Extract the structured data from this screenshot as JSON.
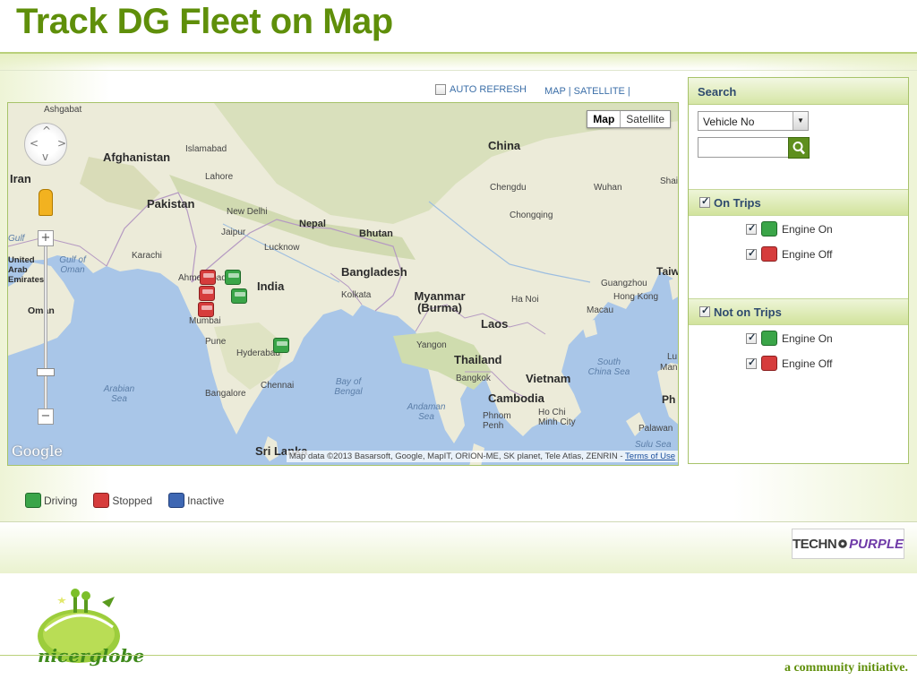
{
  "slide": {
    "title": "Track DG Fleet on Map",
    "footer_tagline": "a community initiative.",
    "footer_logo": "nicerglobe",
    "partner_logo": {
      "part1": "TECHN",
      "part2": "PURPLE"
    }
  },
  "toolbar": {
    "auto_refresh_label": "AUTO REFRESH",
    "map_links": "MAP | SATELLITE |"
  },
  "map": {
    "map_type_buttons": [
      "Map",
      "Satellite"
    ],
    "selected_map_type": "Map",
    "countries": [
      "Afghanistan",
      "Iran",
      "Pakistan",
      "Nepal",
      "Bhutan",
      "India",
      "Bangladesh",
      "China",
      "Myanmar (Burma)",
      "Laos",
      "Thailand",
      "Vietnam",
      "Cambodia",
      "Sri Lanka",
      "Taiw",
      "Ph",
      "United Arab Emirates",
      "Oman"
    ],
    "cities": [
      "Ashgabat",
      "Islamabad",
      "Lahore",
      "New Delhi",
      "Jaipur",
      "Lucknow",
      "Karachi",
      "Ahmedabad",
      "Kolkata",
      "Mumbai",
      "Pune",
      "Hyderabad",
      "Bangalore",
      "Chennai",
      "Yangon",
      "Bangkok",
      "Phnom Penh",
      "Ho Chi Minh City",
      "Ha Noi",
      "Chengdu",
      "Chongqing",
      "Wuhan",
      "Guangzhou",
      "Hong Kong",
      "Macau",
      "Shai",
      "Palawan",
      "Lu",
      "Man"
    ],
    "seas": [
      "Gulf of Oman",
      "Arabian Sea",
      "Bay of Bengal",
      "Andaman Sea",
      "South China Sea",
      "Sulu Sea",
      "Gulf"
    ],
    "google_logo": "Google",
    "attribution": "Map data ©2013 Basarsoft, Google, MapIT, ORION-ME, SK planet, Tele Atlas, ZENRIN -",
    "terms_link": "Terms of Use",
    "zoom_in": "+",
    "zoom_out": "−",
    "vehicles": [
      {
        "status": "stopped",
        "near": "Ahmedabad"
      },
      {
        "status": "driving",
        "near": "Ahmedabad"
      },
      {
        "status": "stopped",
        "near": "Ahmedabad"
      },
      {
        "status": "stopped",
        "near": "Ahmedabad"
      },
      {
        "status": "driving",
        "near": "Indore"
      },
      {
        "status": "driving",
        "near": "Hyderabad"
      }
    ]
  },
  "legend": {
    "items": [
      {
        "label": "Driving",
        "color": "#3aa548"
      },
      {
        "label": "Stopped",
        "color": "#d63c3c"
      },
      {
        "label": "Inactive",
        "color": "#3e67b3"
      }
    ]
  },
  "search_panel": {
    "title": "Search",
    "select_value": "Vehicle No",
    "search_input_value": "",
    "sections": [
      {
        "label": "On Trips",
        "checked": true,
        "options": [
          {
            "label": "Engine On",
            "checked": true,
            "color": "#3aa548"
          },
          {
            "label": "Engine Off",
            "checked": true,
            "color": "#d63c3c"
          }
        ]
      },
      {
        "label": "Not on Trips",
        "checked": true,
        "options": [
          {
            "label": "Engine On",
            "checked": true,
            "color": "#3aa548"
          },
          {
            "label": "Engine Off",
            "checked": true,
            "color": "#d63c3c"
          }
        ]
      }
    ]
  },
  "colors": {
    "accent_green": "#5f8f0a",
    "panel_text": "#2f4b6e",
    "link_blue": "#3c6fa8"
  }
}
